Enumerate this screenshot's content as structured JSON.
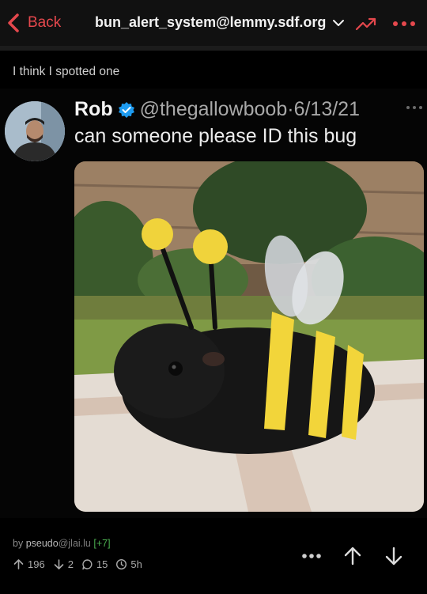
{
  "header": {
    "back_label": "Back",
    "community": "bun_alert_system@lemmy.sdf.org"
  },
  "post": {
    "title": "I think I spotted one",
    "tweet": {
      "author": "Rob",
      "handle": "@thegallowboob",
      "date": "6/13/21",
      "text": "can someone please ID this bug"
    },
    "byline": {
      "prefix": "by ",
      "user": "pseudo",
      "instance": "@jlai.lu",
      "badge": "[+7]"
    },
    "stats": {
      "upvotes": "196",
      "downvotes": "2",
      "comments": "15",
      "age": "5h"
    }
  },
  "colors": {
    "accent": "#e5484d",
    "mod_badge": "#4caf50",
    "verified": "#1d9bf0"
  },
  "icons": [
    "back-chevron-icon",
    "dropdown-chevron-icon",
    "trending-icon",
    "more-dots-icon",
    "verified-badge-icon",
    "upvote-icon",
    "downvote-icon",
    "comment-icon",
    "clock-icon"
  ]
}
